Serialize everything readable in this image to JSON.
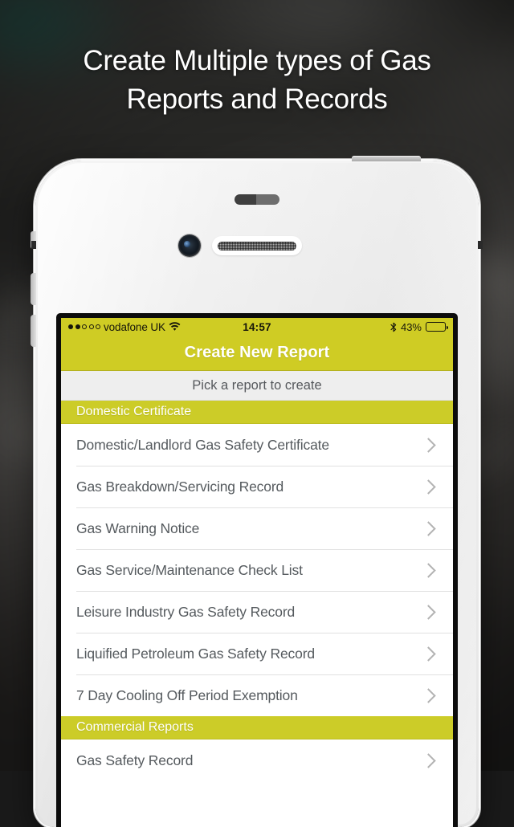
{
  "headline": {
    "line1": "Create Multiple types of Gas",
    "line2": "Reports and Records"
  },
  "colors": {
    "accent_yellow": "#CFCC24",
    "section_yellow": "#CCCC28",
    "subtitle_bg": "#EEEEEE",
    "row_text": "#555A5E",
    "chevron": "#B3B3B3"
  },
  "device": {
    "name": "white-smartphone",
    "hardware": {
      "front_camera": "camera-icon",
      "earpiece": "speaker-grille",
      "proximity_sensor": "proximity-sensor",
      "power_button": "power-button",
      "silent_switch": "silent-switch",
      "volume_up": "volume-up-button",
      "volume_down": "volume-down-button"
    }
  },
  "screen": {
    "status_bar": {
      "signal_dots_filled": 2,
      "signal_dots_total": 5,
      "carrier": "vodafone UK",
      "wifi_icon": "wifi-icon",
      "time": "14:57",
      "bluetooth_icon": "bluetooth-icon",
      "battery_percent_label": "43%",
      "battery_level": 43
    },
    "nav_bar": {
      "title": "Create New Report"
    },
    "subtitle": "Pick a report to create",
    "sections": [
      {
        "header": "Domestic Certificate",
        "rows": [
          {
            "label": "Domestic/Landlord Gas Safety Certificate",
            "chevron": "chevron-right-icon"
          },
          {
            "label": "Gas Breakdown/Servicing Record",
            "chevron": "chevron-right-icon"
          },
          {
            "label": "Gas Warning Notice",
            "chevron": "chevron-right-icon"
          },
          {
            "label": "Gas Service/Maintenance Check List",
            "chevron": "chevron-right-icon"
          },
          {
            "label": "Leisure Industry Gas Safety Record",
            "chevron": "chevron-right-icon"
          },
          {
            "label": "Liquified Petroleum Gas Safety Record",
            "chevron": "chevron-right-icon"
          },
          {
            "label": "7 Day Cooling Off Period Exemption",
            "chevron": "chevron-right-icon"
          }
        ]
      },
      {
        "header": "Commercial Reports",
        "rows": [
          {
            "label": "Gas Safety Record",
            "chevron": "chevron-right-icon"
          }
        ]
      }
    ]
  }
}
